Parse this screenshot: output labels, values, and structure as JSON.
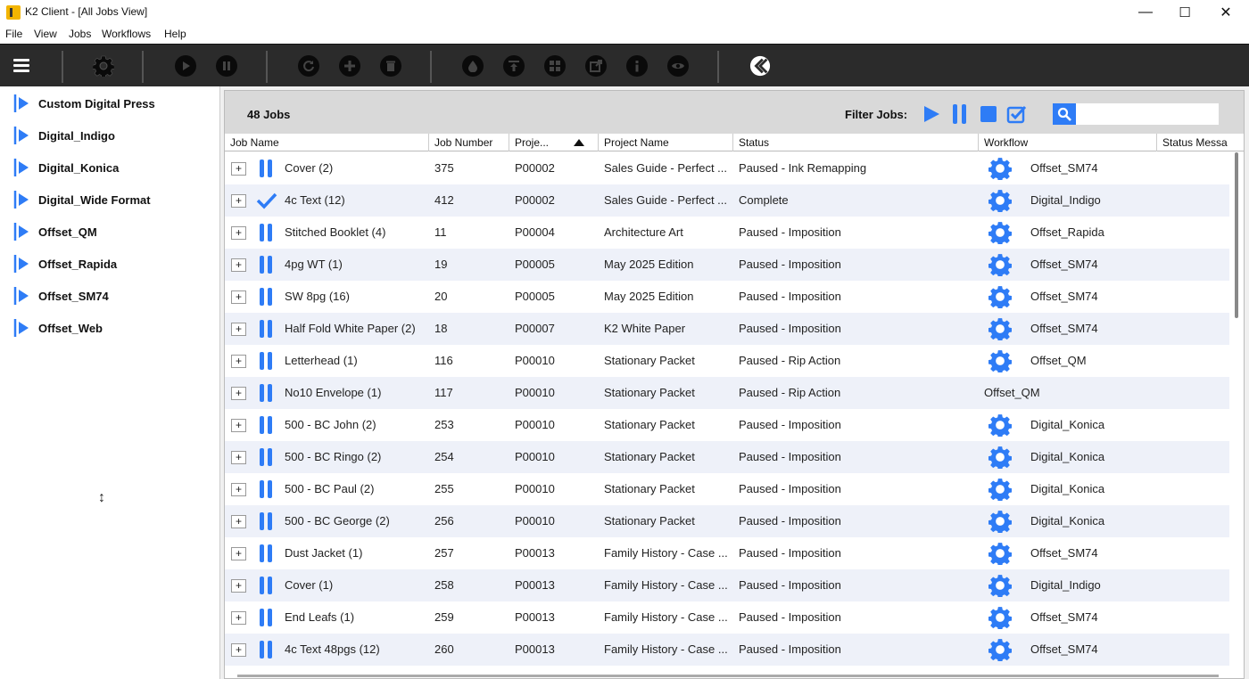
{
  "window": {
    "title": "K2 Client - [All Jobs View]",
    "minimize": "—",
    "maximize": "☐",
    "close": "✕"
  },
  "menu": [
    "File",
    "View",
    "Jobs",
    "Workflows",
    "Help"
  ],
  "colors": {
    "accent": "#2e7cf6",
    "toolbar_bg": "#2b2b2b",
    "row_alt": "#eef1f9"
  },
  "toolbar": {
    "icons": [
      "menu-icon",
      "settings-gear-icon",
      "play-icon",
      "pause-icon",
      "refresh-icon",
      "add-icon",
      "delete-icon",
      "ink-drop-icon",
      "upload-icon",
      "grid-icon",
      "export-icon",
      "info-icon",
      "view-eye-icon",
      "k2-logo-icon"
    ]
  },
  "sidebar": {
    "items": [
      {
        "label": "Custom Digital Press"
      },
      {
        "label": "Digital_Indigo"
      },
      {
        "label": "Digital_Konica"
      },
      {
        "label": "Digital_Wide Format"
      },
      {
        "label": "Offset_QM"
      },
      {
        "label": "Offset_Rapida"
      },
      {
        "label": "Offset_SM74"
      },
      {
        "label": "Offset_Web"
      }
    ]
  },
  "jobs_panel": {
    "count_label": "48 Jobs",
    "filter_label": "Filter Jobs:",
    "search": {
      "placeholder": "",
      "value": ""
    },
    "columns": [
      "Job Name",
      "Job Number",
      "Proje...",
      "Project Name",
      "Status",
      "Workflow",
      "Status Messa"
    ],
    "sort_column": "Proje...",
    "rows": [
      {
        "state": "paused",
        "job_name": "Cover (2)",
        "job_number": "375",
        "project": "P00002",
        "project_name": "Sales Guide - Perfect ...",
        "status": "Paused - Ink Remapping",
        "workflow": "Offset_SM74",
        "gear": true
      },
      {
        "state": "complete",
        "job_name": "4c Text (12)",
        "job_number": "412",
        "project": "P00002",
        "project_name": "Sales Guide - Perfect ...",
        "status": "Complete",
        "workflow": "Digital_Indigo",
        "gear": true
      },
      {
        "state": "paused",
        "job_name": "Stitched Booklet (4)",
        "job_number": "11",
        "project": "P00004",
        "project_name": "Architecture Art",
        "status": "Paused - Imposition",
        "workflow": "Offset_Rapida",
        "gear": true
      },
      {
        "state": "paused",
        "job_name": "4pg WT (1)",
        "job_number": "19",
        "project": "P00005",
        "project_name": "May 2025 Edition",
        "status": "Paused - Imposition",
        "workflow": "Offset_SM74",
        "gear": true
      },
      {
        "state": "paused",
        "job_name": "SW 8pg (16)",
        "job_number": "20",
        "project": "P00005",
        "project_name": "May 2025 Edition",
        "status": "Paused - Imposition",
        "workflow": "Offset_SM74",
        "gear": true
      },
      {
        "state": "paused",
        "job_name": "Half Fold White Paper (2)",
        "job_number": "18",
        "project": "P00007",
        "project_name": "K2 White Paper",
        "status": "Paused - Imposition",
        "workflow": "Offset_SM74",
        "gear": true
      },
      {
        "state": "paused",
        "job_name": "Letterhead (1)",
        "job_number": "116",
        "project": "P00010",
        "project_name": "Stationary Packet",
        "status": "Paused - Rip Action",
        "workflow": "Offset_QM",
        "gear": true
      },
      {
        "state": "paused",
        "job_name": "No10 Envelope (1)",
        "job_number": "117",
        "project": "P00010",
        "project_name": "Stationary Packet",
        "status": "Paused - Rip Action",
        "workflow": "Offset_QM",
        "gear": false
      },
      {
        "state": "paused",
        "job_name": "500 - BC John (2)",
        "job_number": "253",
        "project": "P00010",
        "project_name": "Stationary Packet",
        "status": "Paused - Imposition",
        "workflow": "Digital_Konica",
        "gear": true
      },
      {
        "state": "paused",
        "job_name": "500 - BC Ringo (2)",
        "job_number": "254",
        "project": "P00010",
        "project_name": "Stationary Packet",
        "status": "Paused - Imposition",
        "workflow": "Digital_Konica",
        "gear": true
      },
      {
        "state": "paused",
        "job_name": "500 - BC Paul (2)",
        "job_number": "255",
        "project": "P00010",
        "project_name": "Stationary Packet",
        "status": "Paused - Imposition",
        "workflow": "Digital_Konica",
        "gear": true
      },
      {
        "state": "paused",
        "job_name": "500 - BC George (2)",
        "job_number": "256",
        "project": "P00010",
        "project_name": "Stationary Packet",
        "status": "Paused - Imposition",
        "workflow": "Digital_Konica",
        "gear": true
      },
      {
        "state": "paused",
        "job_name": "Dust Jacket (1)",
        "job_number": "257",
        "project": "P00013",
        "project_name": "Family History - Case ...",
        "status": "Paused - Imposition",
        "workflow": "Offset_SM74",
        "gear": true
      },
      {
        "state": "paused",
        "job_name": "Cover (1)",
        "job_number": "258",
        "project": "P00013",
        "project_name": "Family History - Case ...",
        "status": "Paused - Imposition",
        "workflow": "Digital_Indigo",
        "gear": true
      },
      {
        "state": "paused",
        "job_name": "End Leafs (1)",
        "job_number": "259",
        "project": "P00013",
        "project_name": "Family History - Case ...",
        "status": "Paused - Imposition",
        "workflow": "Offset_SM74",
        "gear": true
      },
      {
        "state": "paused",
        "job_name": "4c Text 48pgs (12)",
        "job_number": "260",
        "project": "P00013",
        "project_name": "Family History - Case ...",
        "status": "Paused - Imposition",
        "workflow": "Offset_SM74",
        "gear": true
      }
    ]
  }
}
